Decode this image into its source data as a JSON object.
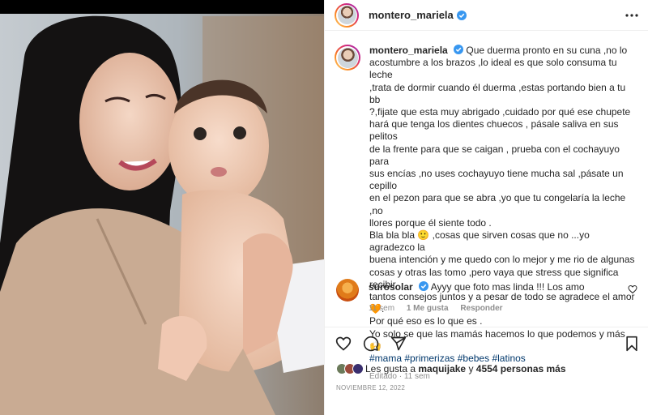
{
  "post": {
    "username": "montero_mariela",
    "more_icon": "more-horizontal-icon"
  },
  "caption": {
    "username": "montero_mariela",
    "lines": [
      "Que duerma pronto en su cuna ,no lo",
      "acostumbre a los brazos ,lo ideal es que solo consuma tu leche",
      ",trata de dormir cuando él duerma ,estas portando bien a tu bb",
      "?,fijate que esta muy abrigado ,cuidado por qué ese chupete",
      "hará que tenga los dientes chuecos , pásale saliva en sus pelitos",
      "de la frente para que se caigan , prueba con el cochayuyo para",
      "sus encías ,no uses cochayuyo tiene mucha sal ,pásate un cepillo",
      "en el pezon para que se abra ,yo que tu congelaría la leche ,no",
      "llores porque él siente todo .",
      "Bla bla bla 🙂 ,cosas que sirven cosas que no ...yo agradezco la",
      "buena intención y me quedo con lo mejor y me rio de algunas",
      "cosas y otras las tomo ,pero vaya que stress que significa recibir",
      "tantos consejos juntos y a pesar de todo se agradece el amor",
      "🧡.",
      "Por qué eso es lo que es .",
      "Yo solo se que las mamás hacemos lo que podemos y más 🙌"
    ],
    "hashtags": [
      "#mama",
      "#primerizas",
      "#bebes",
      "#latinos"
    ],
    "edited": "Editado",
    "time": "11 sem"
  },
  "comment": {
    "username": "surosolar",
    "text": "Ayyy que foto mas linda !!! Los amo",
    "time": "11 sem",
    "likes": "1 Me gusta",
    "reply": "Responder"
  },
  "actions": {
    "icons": [
      "heart-icon",
      "comment-icon",
      "share-icon",
      "bookmark-icon"
    ]
  },
  "likes": {
    "prefix": "Les gusta a",
    "first_user": "maquijake",
    "connector": "y",
    "others": "4554 personas más"
  },
  "date": "NOVIEMBRE 12, 2022",
  "colors": {
    "verified": "#3897f0",
    "hashtag": "#00376b",
    "meta": "#8e8e8e"
  }
}
